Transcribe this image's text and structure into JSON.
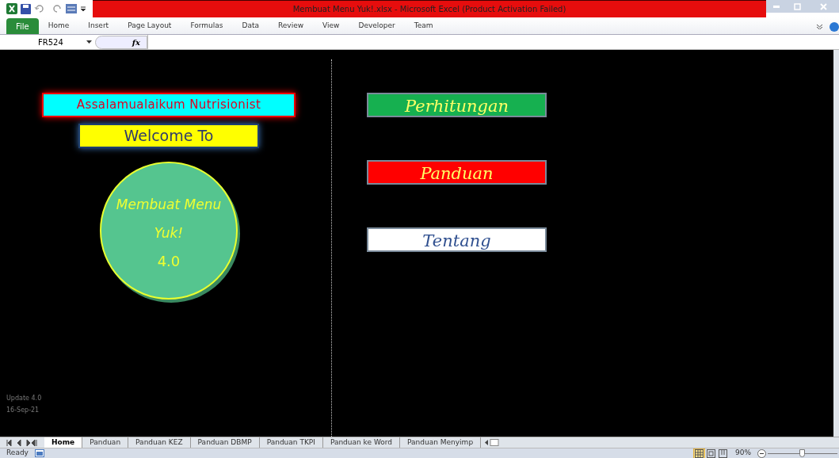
{
  "window": {
    "title": "Membuat Menu Yuk!.xlsx  -  Microsoft Excel (Product Activation Failed)"
  },
  "ribbon_tabs": [
    {
      "label": "File",
      "selected": false,
      "kind": "file"
    },
    {
      "label": "Home",
      "selected": false
    },
    {
      "label": "Insert",
      "selected": false
    },
    {
      "label": "Page Layout",
      "selected": false
    },
    {
      "label": "Formulas",
      "selected": false
    },
    {
      "label": "Data",
      "selected": false
    },
    {
      "label": "Review",
      "selected": false
    },
    {
      "label": "View",
      "selected": false
    },
    {
      "label": "Developer",
      "selected": false
    },
    {
      "label": "Team",
      "selected": false
    }
  ],
  "formula_bar": {
    "name_box": "FR524",
    "fx": "fx"
  },
  "sheet": {
    "greeting": "Assalamualaikum Nutrisionist",
    "welcome": "Welcome To",
    "badge_lines": [
      "Membuat Menu",
      "Yuk!"
    ],
    "version": "4.0",
    "menu_buttons": [
      {
        "label": "Perhitungan",
        "color": "#16b050"
      },
      {
        "label": "Panduan",
        "color": "#ff0000"
      },
      {
        "label": "Tentang",
        "color": "#ffffff"
      }
    ],
    "footer": [
      "Update 4.0",
      "16-Sep-21"
    ]
  },
  "sheet_tabs": [
    {
      "label": "Home",
      "selected": true
    },
    {
      "label": "Panduan",
      "selected": false
    },
    {
      "label": "Panduan KEZ",
      "selected": false
    },
    {
      "label": "Panduan DBMP",
      "selected": false
    },
    {
      "label": "Panduan TKPI",
      "selected": false
    },
    {
      "label": "Panduan ke Word",
      "selected": false
    },
    {
      "label": "Panduan Menyimp",
      "selected": false
    }
  ],
  "status_bar": {
    "status": "Ready",
    "views": [
      {
        "kind": "normal",
        "selected": true
      },
      {
        "kind": "page-layout",
        "selected": false
      },
      {
        "kind": "page-break",
        "selected": false
      }
    ],
    "zoom": "90%",
    "zoom_level": {
      "level": 0.5
    }
  }
}
